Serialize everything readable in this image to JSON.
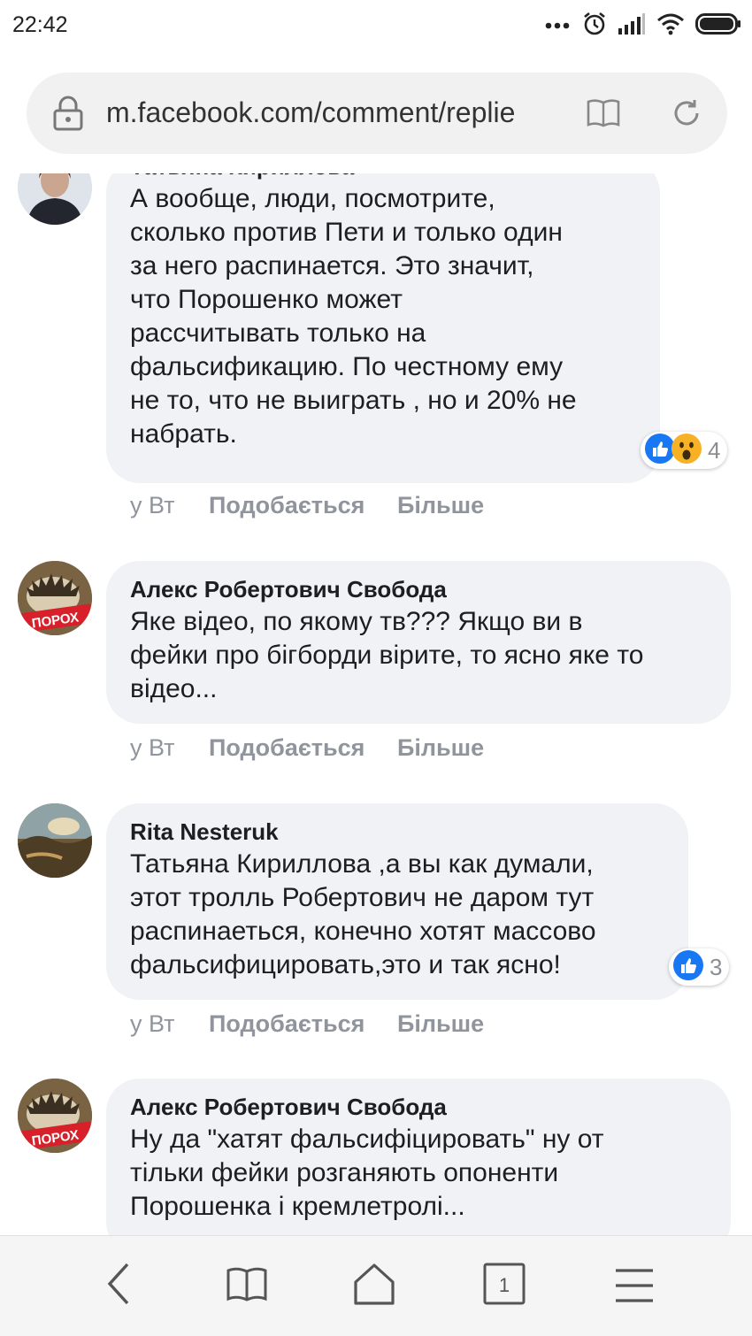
{
  "status": {
    "time": "22:42"
  },
  "browser": {
    "url": "m.facebook.com/comment/replie",
    "tab_count": "1"
  },
  "colors": {
    "like_blue": "#1877f2",
    "bubble_bg": "#f0f2f5",
    "meta_gray": "#90949c"
  },
  "comments": [
    {
      "author": "Татьяна Кириллова",
      "text": "А вообще, люди, посмотрите,\nсколько против Пети и только один\nза него распинается. Это значит,\nчто Порошенко может\nрассчитывать только на\nфальсификацию. По честному ему\nне то, что не выиграть , но и 20% не\nнабрать.",
      "time": "у Вт",
      "like_label": "Подобається",
      "more_label": "Більше",
      "reactions": [
        "like-icon",
        "wow-icon"
      ],
      "reaction_count": "4"
    },
    {
      "author": "Алекс Робертович Свобода",
      "text": "Яке відео, по якому тв??? Якщо ви в\nфейки про бігборди вірите, то ясно яке то\nвідео...",
      "time": "у Вт",
      "like_label": "Подобається",
      "more_label": "Більше"
    },
    {
      "author": "Rita Nesteruk",
      "text": "Татьяна Кириллова ,а вы как думали,\nэтот тролль Робертович не даром тут\nраспинаеться, конечно хотят массово\nфальсифицировать,это и так ясно!",
      "time": "у Вт",
      "like_label": "Подобається",
      "more_label": "Більше",
      "reactions": [
        "like-icon"
      ],
      "reaction_count": "3"
    },
    {
      "author": "Алекс Робертович Свобода",
      "text": "Ну да \"хатят фальсифіцировать\" ну от\nтільки фейки розганяють опоненти\nПорошенка і кремлетролі..."
    }
  ],
  "avatar_badge_text": "ПОРОХ"
}
